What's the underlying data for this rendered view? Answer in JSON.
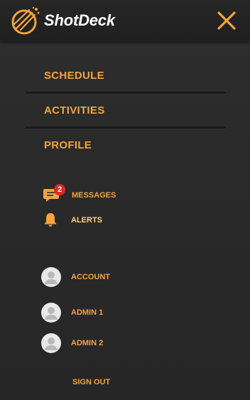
{
  "brand": {
    "name": "ShotDeck",
    "logo_icon": "shotdeck-logo-icon",
    "close_icon": "close-icon"
  },
  "colors": {
    "accent": "#f4a340",
    "badge": "#e32626",
    "background": "#2a2a2a",
    "header": "#222222",
    "avatar": "#e9e9e9"
  },
  "nav": {
    "items": [
      {
        "label": "SCHEDULE"
      },
      {
        "label": "ACTIVITIES"
      },
      {
        "label": "PROFILE"
      }
    ]
  },
  "notifications": {
    "messages": {
      "label": "MESSAGES",
      "badge_count": "2",
      "icon": "message-icon"
    },
    "alerts": {
      "label": "ALERTS",
      "icon": "bell-icon"
    }
  },
  "accounts": {
    "items": [
      {
        "label": "ACCOUNT",
        "icon": "avatar-icon"
      },
      {
        "label": "ADMIN 1",
        "icon": "avatar-icon"
      },
      {
        "label": "ADMIN 2",
        "icon": "avatar-icon"
      }
    ]
  },
  "sign_out_label": "SIGN OUT"
}
